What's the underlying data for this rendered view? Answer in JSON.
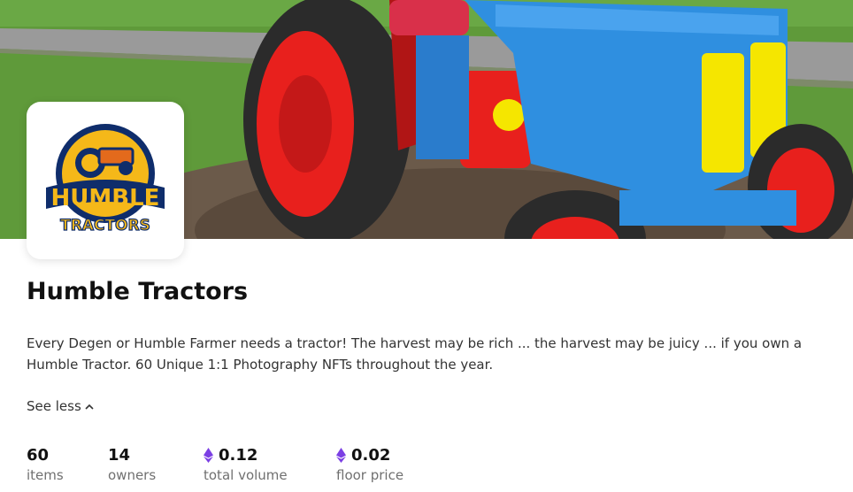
{
  "collection": {
    "name": "Humble Tractors",
    "description": "Every Degen or Humble Farmer needs a tractor! The harvest may be rich ... the harvest may be juicy ... if you own a Humble Tractor. 60 Unique 1:1 Photography NFTs throughout the year.",
    "see_less_label": "See less",
    "logo": {
      "line1": "HUMBLE",
      "line2": "TRACTORS"
    }
  },
  "stats": [
    {
      "value": "60",
      "label": "items",
      "currency_icon": null
    },
    {
      "value": "14",
      "label": "owners",
      "currency_icon": null
    },
    {
      "value": "0.12",
      "label": "total volume",
      "currency_icon": "ethereum-icon"
    },
    {
      "value": "0.02",
      "label": "floor price",
      "currency_icon": "ethereum-icon"
    }
  ],
  "colors": {
    "eth": "#7b3fe4",
    "tractor_blue": "#2f8fe0",
    "wheel_red": "#e8201d",
    "logo_yellow": "#f5b819",
    "logo_navy": "#0f2d6b"
  }
}
